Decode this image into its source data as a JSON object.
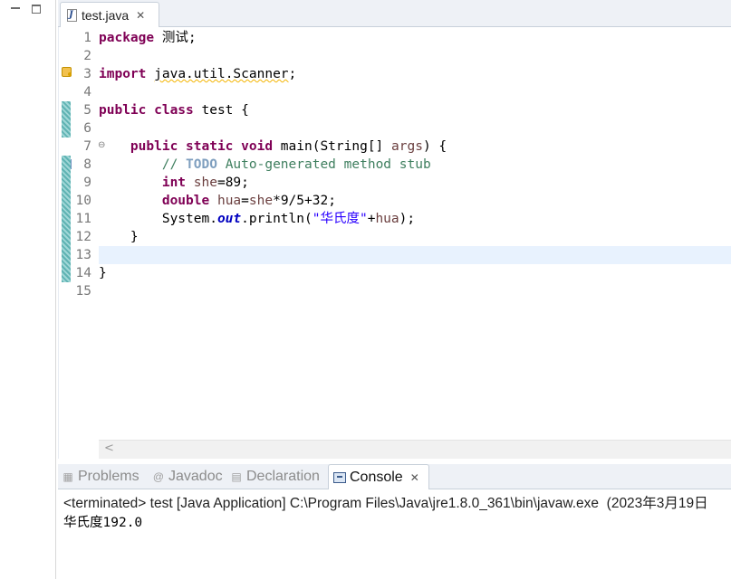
{
  "left_pane": {
    "minimize_label": "",
    "maximize_label": ""
  },
  "editor": {
    "tab": {
      "label": "test.java",
      "icon": "java-file-icon",
      "close_icon": "close-icon"
    },
    "line_numbers": [
      "1",
      "2",
      "3",
      "4",
      "5",
      "6",
      "7",
      "8",
      "9",
      "10",
      "11",
      "12",
      "13",
      "14",
      "15"
    ],
    "code": {
      "l1_kw": "package",
      "l1_rest": " 测试;",
      "l3_kw": "import",
      "l3_space": " ",
      "l3_import": "java.util.Scanner",
      "l3_semi": ";",
      "l5_kw": "public class",
      "l5_rest": " test {",
      "l7_indent": "    ",
      "l7_kw": "public static void",
      "l7_mid": " main(String[] ",
      "l7_var": "args",
      "l7_end": ") {",
      "l8_indent": "        ",
      "l8_cmt1": "// ",
      "l8_todo": "TODO",
      "l8_cmt2": " Auto-generated method stub",
      "l9_indent": "        ",
      "l9_kw": "int",
      "l9_var": " she",
      "l9_rest": "=89;",
      "l10_indent": "        ",
      "l10_kw": "double",
      "l10_var1": " hua",
      "l10_eq": "=",
      "l10_var2": "she",
      "l10_rest": "*9/5+32;",
      "l11_indent": "        ",
      "l11_sys": "System.",
      "l11_out": "out",
      "l11_call": ".println(",
      "l11_str": "\"华氏度\"",
      "l11_plus": "+",
      "l11_var": "hua",
      "l11_end": ");",
      "l12": "    }",
      "l14": "}"
    },
    "current_line": 13,
    "colors": {
      "keyword": "#7f0055",
      "comment": "#3f7f5f",
      "string": "#2a00ff",
      "field": "#0000c0",
      "variable": "#6a3e3e",
      "current_line_bg": "#e8f2fe"
    }
  },
  "console_view": {
    "tabs": [
      {
        "label": "Problems",
        "icon": "problems-icon"
      },
      {
        "label": "Javadoc",
        "icon": "at-icon"
      },
      {
        "label": "Declaration",
        "icon": "declaration-icon"
      },
      {
        "label": "Console",
        "icon": "console-icon",
        "active": true
      }
    ],
    "status": "<terminated> test [Java Application] C:\\Program Files\\Java\\jre1.8.0_361\\bin\\javaw.exe  (2023年3月19日",
    "output": "华氏度192.0"
  }
}
